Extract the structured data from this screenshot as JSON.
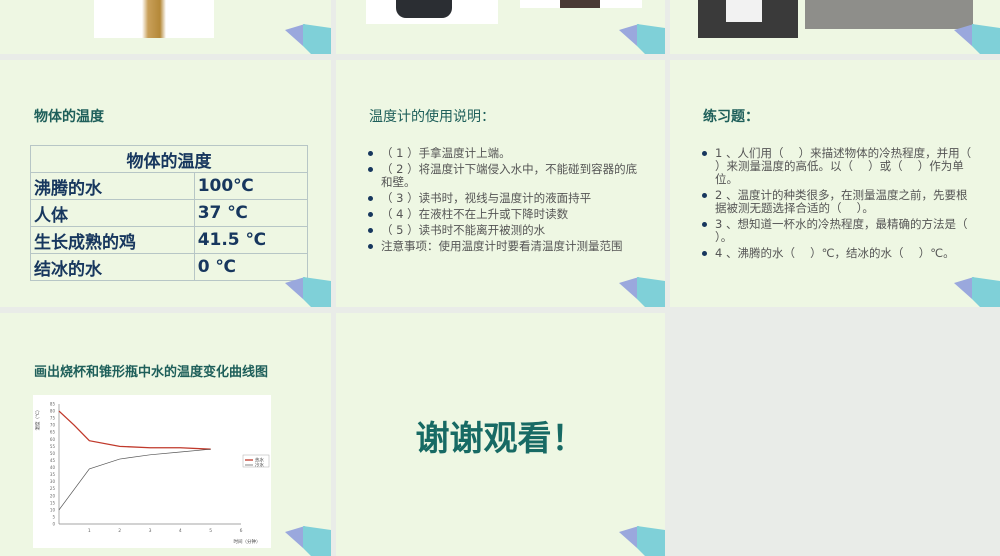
{
  "slides": [
    {
      "id": 1
    },
    {
      "id": 2
    },
    {
      "id": 3
    },
    {
      "id": 4,
      "title": "物体的温度",
      "table": {
        "header": "物体的温度",
        "rows": [
          [
            "沸腾的水",
            "100℃"
          ],
          [
            "人体",
            "37 ℃"
          ],
          [
            "生长成熟的鸡",
            "41.5 ℃"
          ],
          [
            "结冰的水",
            "0 ℃"
          ]
        ]
      }
    },
    {
      "id": 5,
      "title": "温度计的使用说明：",
      "bullets": [
        "（ 1 ）手拿温度计上端。",
        "（ 2 ）将温度计下端侵入水中，不能碰到容器的底和壁。",
        "（ 3 ）读书时，视线与温度计的液面持平",
        "（ 4 ）在液柱不在上升或下降时读数",
        "（ 5 ）读书时不能离开被测的水",
        "注意事项：使用温度计时要看清温度计测量范围"
      ]
    },
    {
      "id": 6,
      "title": "练习题：",
      "bullets": [
        "1 、人们用（　 ）来描述物体的冷热程度，并用（　 ）来测量温度的高低。以（　 ）或（　 ）作为单位。",
        "2 、温度计的种类很多，在测量温度之前，先要根据被测无题选择合适的（　 ）。",
        "3 、想知道一杯水的冷热程度，最精确的方法是（　 ）。",
        "4 、沸腾的水（　 ）℃，结冰的水（　 ）℃。"
      ]
    },
    {
      "id": 7,
      "title": "画出烧杯和锥形瓶中水的温度变化曲线图"
    },
    {
      "id": 8,
      "text": "谢谢观看！"
    }
  ],
  "chart_data": {
    "type": "line",
    "title": "",
    "xlabel": "时间（分钟）",
    "ylabel": "温度（℃）",
    "xlim": [
      0,
      6
    ],
    "ylim": [
      0,
      85
    ],
    "xticks": [
      1,
      2,
      3,
      4,
      5,
      6
    ],
    "yticks": [
      0,
      5,
      10,
      15,
      20,
      25,
      30,
      35,
      40,
      45,
      50,
      55,
      60,
      65,
      70,
      75,
      80,
      85
    ],
    "legend_position": "right",
    "series": [
      {
        "name": "热水",
        "color": "#c0392b",
        "x": [
          0,
          0.5,
          1,
          2,
          3,
          4,
          5
        ],
        "y": [
          80,
          70,
          59,
          55,
          54,
          54,
          53
        ]
      },
      {
        "name": "冷水",
        "color": "#555555",
        "x": [
          0,
          1,
          2,
          3,
          4,
          5
        ],
        "y": [
          10,
          39,
          46,
          49,
          51,
          53
        ]
      }
    ]
  }
}
